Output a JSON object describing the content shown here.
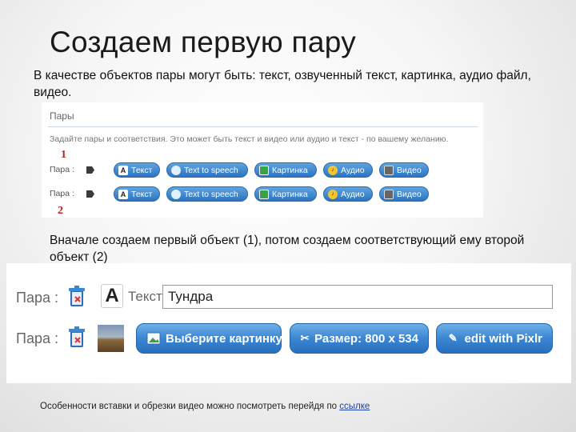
{
  "slide": {
    "title": "Создаем первую пару",
    "intro": "В качестве объектов пары могут быть: текст, озвученный текст, картинка, аудио файл, видео.",
    "note": "Вначале создаем первый объект (1), потом создаем соответствующий ему второй объект (2)",
    "footer_text": "Особенности вставки и обрезки видео можно посмотреть перейдя по",
    "footer_link": "ссылке"
  },
  "panel1": {
    "heading": "Пары",
    "description": "Задайте пары и соответствия. Это может быть текст и видео или аудио и текст - по вашему желанию.",
    "marker_1": "1",
    "marker_2": "2",
    "rows": [
      {
        "label": "Пара :",
        "buttons": [
          "Текст",
          "Text to speech",
          "Картинка",
          "Аудио",
          "Видео"
        ]
      },
      {
        "label": "Пара :",
        "buttons": [
          "Текст",
          "Text to speech",
          "Картинка",
          "Аудио",
          "Видео"
        ]
      }
    ]
  },
  "panel2": {
    "row1": {
      "label": "Пара :",
      "text_label": "Текст:",
      "text_value": "Тундра"
    },
    "row2": {
      "label": "Пара :",
      "buttons": [
        "Выберите картинку",
        "Размер: 800 x 534",
        "edit with Pixlr"
      ]
    }
  },
  "colors": {
    "button_blue": "#3b86d2",
    "marker_red": "#c02020",
    "link_blue": "#1a3fa8"
  },
  "icons": [
    "letter-a-icon",
    "speech-bubble-icon",
    "picture-icon",
    "audio-icon",
    "video-icon",
    "trash-icon",
    "crop-icon",
    "pixlr-icon",
    "arrow-tag-icon"
  ]
}
